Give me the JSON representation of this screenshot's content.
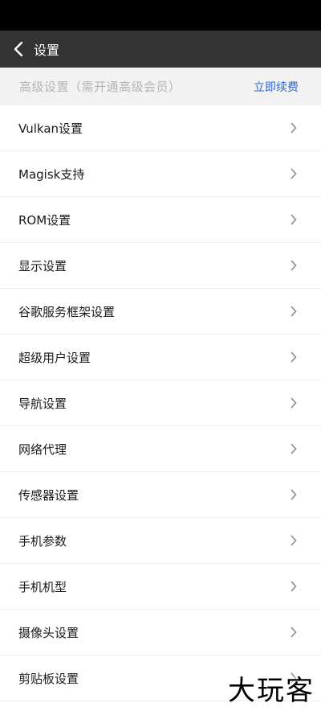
{
  "header": {
    "title": "设置",
    "back_icon": "chevron-left-icon"
  },
  "premium": {
    "text": "高级设置（需开通高级会员）",
    "action_label": "立即续费",
    "action_color": "#3366cc"
  },
  "menu": [
    {
      "label": "Vulkan设置"
    },
    {
      "label": "Magisk支持"
    },
    {
      "label": "ROM设置"
    },
    {
      "label": "显示设置"
    },
    {
      "label": "谷歌服务框架设置"
    },
    {
      "label": "超级用户设置"
    },
    {
      "label": "导航设置"
    },
    {
      "label": "网络代理"
    },
    {
      "label": "传感器设置"
    },
    {
      "label": "手机参数"
    },
    {
      "label": "手机机型"
    },
    {
      "label": "摄像头设置"
    },
    {
      "label": "剪贴板设置"
    }
  ],
  "watermark": {
    "text": "大玩客"
  }
}
